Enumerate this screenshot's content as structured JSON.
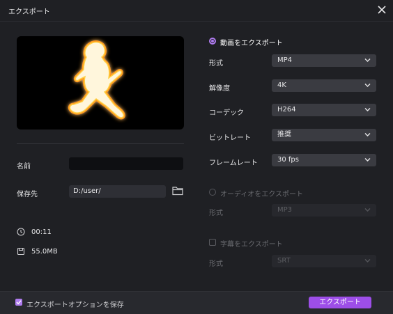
{
  "window": {
    "title": "エクスポート"
  },
  "left": {
    "name_label": "名前",
    "name_value": "",
    "save_label": "保存先",
    "save_path": "D:/user/",
    "duration": "00:11",
    "size": "55.0MB"
  },
  "video_export": {
    "title": "動画をエクスポート",
    "selected": true,
    "rows": [
      {
        "label": "形式",
        "value": "MP4"
      },
      {
        "label": "解像度",
        "value": "4K"
      },
      {
        "label": "コーデック",
        "value": "H264"
      },
      {
        "label": "ビットレート",
        "value": "推奨"
      },
      {
        "label": "フレームレート",
        "value": "30 fps"
      }
    ]
  },
  "audio_export": {
    "title": "オーディオをエクスポート",
    "selected": false,
    "format_label": "形式",
    "format_value": "MP3"
  },
  "subtitle_export": {
    "title": "字幕をエクスポート",
    "checked": false,
    "format_label": "形式",
    "format_value": "SRT"
  },
  "footer": {
    "save_option_label": "エクスポートオプションを保存",
    "save_option_checked": true,
    "export_button": "エクスポート"
  },
  "colors": {
    "accent": "#9d4ee8",
    "radio": "#b07cf0",
    "background": "#1f2024"
  }
}
